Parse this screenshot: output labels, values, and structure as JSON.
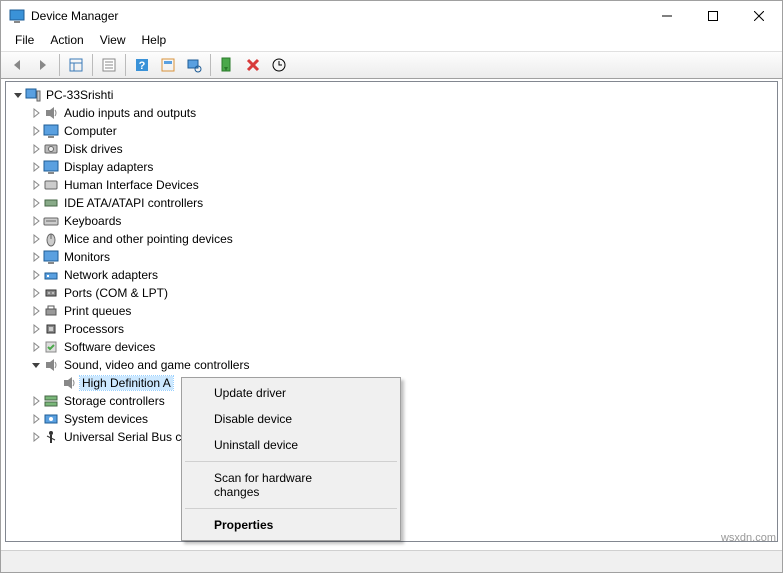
{
  "title": "Device Manager",
  "menu": {
    "file": "File",
    "action": "Action",
    "view": "View",
    "help": "Help"
  },
  "root": "PC-33Srishti",
  "categories": [
    {
      "label": "Audio inputs and outputs",
      "icon": "speaker"
    },
    {
      "label": "Computer",
      "icon": "monitor"
    },
    {
      "label": "Disk drives",
      "icon": "disk"
    },
    {
      "label": "Display adapters",
      "icon": "monitor"
    },
    {
      "label": "Human Interface Devices",
      "icon": "hid"
    },
    {
      "label": "IDE ATA/ATAPI controllers",
      "icon": "ide"
    },
    {
      "label": "Keyboards",
      "icon": "keyboard"
    },
    {
      "label": "Mice and other pointing devices",
      "icon": "mouse"
    },
    {
      "label": "Monitors",
      "icon": "monitor"
    },
    {
      "label": "Network adapters",
      "icon": "network"
    },
    {
      "label": "Ports (COM & LPT)",
      "icon": "port"
    },
    {
      "label": "Print queues",
      "icon": "printer"
    },
    {
      "label": "Processors",
      "icon": "cpu"
    },
    {
      "label": "Software devices",
      "icon": "software"
    },
    {
      "label": "Sound, video and game controllers",
      "icon": "speaker",
      "expanded": true,
      "children": [
        {
          "label": "High Definition A",
          "icon": "speaker",
          "selected": true
        }
      ]
    },
    {
      "label": "Storage controllers",
      "icon": "storage"
    },
    {
      "label": "System devices",
      "icon": "system"
    },
    {
      "label": "Universal Serial Bus c",
      "icon": "usb"
    }
  ],
  "context_menu": {
    "update": "Update driver",
    "disable": "Disable device",
    "uninstall": "Uninstall device",
    "scan": "Scan for hardware changes",
    "properties": "Properties"
  },
  "watermark": "wsxdn.com"
}
